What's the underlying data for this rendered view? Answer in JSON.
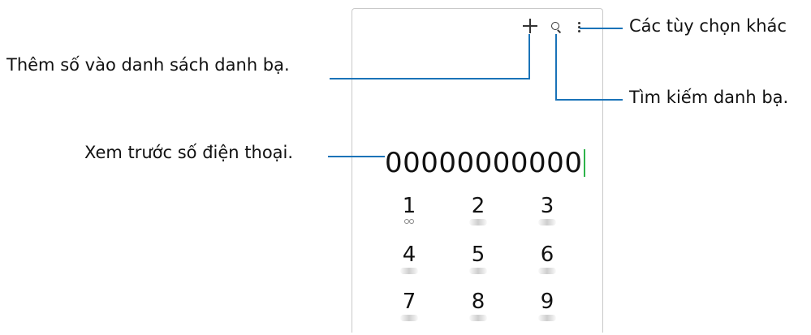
{
  "callouts": {
    "more_options": "Các tùy chọn khác",
    "add_contact": "Thêm số vào danh sách danh bạ.",
    "search_contacts": "Tìm kiếm danh bạ.",
    "preview_number": "Xem trước số điện thoại."
  },
  "dialer": {
    "number": "00000000000",
    "keys": [
      {
        "digit": "1",
        "sub": "voicemail-icon"
      },
      {
        "digit": "2"
      },
      {
        "digit": "3"
      },
      {
        "digit": "4"
      },
      {
        "digit": "5"
      },
      {
        "digit": "6"
      },
      {
        "digit": "7"
      },
      {
        "digit": "8"
      },
      {
        "digit": "9"
      }
    ]
  },
  "colors": {
    "callout_line": "#1a73b8",
    "cursor": "#2db34a"
  }
}
